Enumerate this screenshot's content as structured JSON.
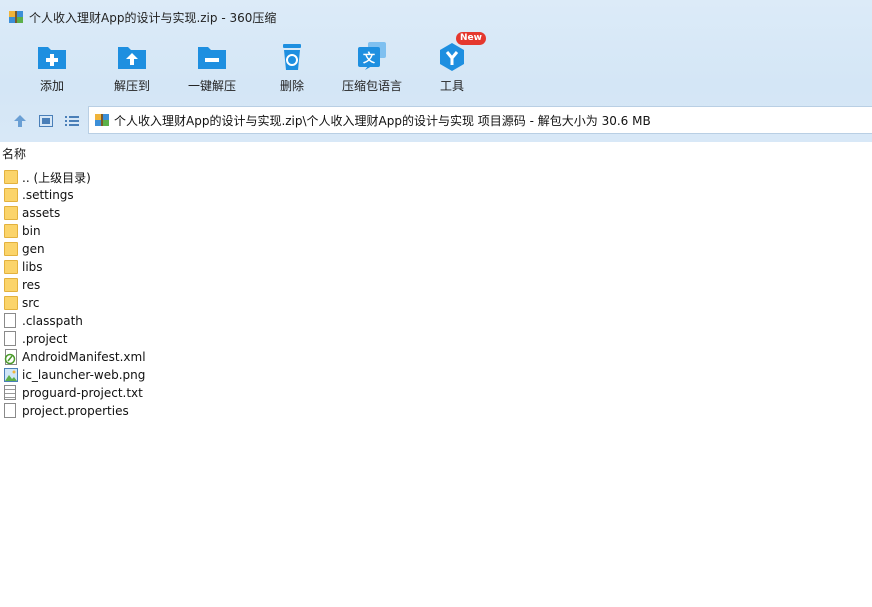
{
  "window": {
    "title": "个人收入理财App的设计与实现.zip - 360压缩"
  },
  "toolbar": {
    "items": [
      {
        "label": "添加",
        "icon": "add-icon"
      },
      {
        "label": "解压到",
        "icon": "extract-to-icon"
      },
      {
        "label": "一键解压",
        "icon": "one-click-extract-icon"
      },
      {
        "label": "删除",
        "icon": "delete-icon"
      },
      {
        "label": "压缩包语言",
        "icon": "archive-language-icon"
      },
      {
        "label": "工具",
        "icon": "tools-icon",
        "badge": "New"
      }
    ]
  },
  "nav": {
    "path": "个人收入理财App的设计与实现.zip\\个人收入理财App的设计与实现 项目源码 - 解包大小为 30.6 MB"
  },
  "list": {
    "column_header": "名称",
    "items": [
      {
        "name": ".. (上级目录)",
        "type": "folder"
      },
      {
        "name": ".settings",
        "type": "folder"
      },
      {
        "name": "assets",
        "type": "folder"
      },
      {
        "name": "bin",
        "type": "folder"
      },
      {
        "name": "gen",
        "type": "folder"
      },
      {
        "name": "libs",
        "type": "folder"
      },
      {
        "name": "res",
        "type": "folder"
      },
      {
        "name": "src",
        "type": "folder"
      },
      {
        "name": ".classpath",
        "type": "file"
      },
      {
        "name": ".project",
        "type": "file"
      },
      {
        "name": "AndroidManifest.xml",
        "type": "xml"
      },
      {
        "name": "ic_launcher-web.png",
        "type": "image"
      },
      {
        "name": "proguard-project.txt",
        "type": "text"
      },
      {
        "name": "project.properties",
        "type": "file"
      }
    ]
  },
  "colors": {
    "accent": "#1e8fe0",
    "folder": "#fbd46a",
    "badge": "#e5382e",
    "header_bg": "#d8e8f7"
  }
}
